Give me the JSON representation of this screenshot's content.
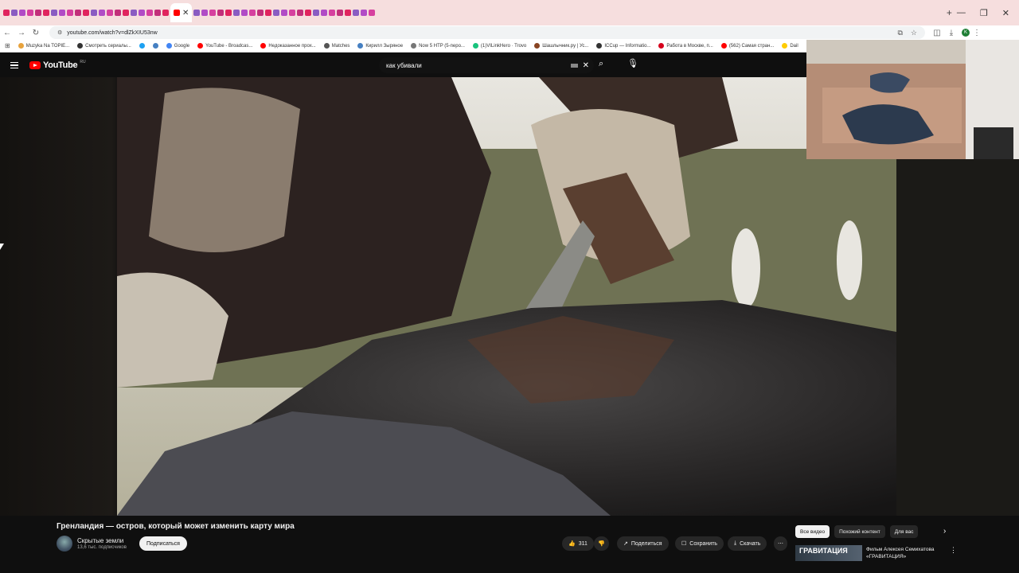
{
  "browser": {
    "url": "youtube.com/watch?v=dlZkXIU53nw",
    "bookmarks": [
      {
        "label": "Muzyka Na TOPIE...",
        "color": "#e8a33d"
      },
      {
        "label": "Смотреть сериалы...",
        "color": "#333333"
      },
      {
        "label": "",
        "color": "#1da1f2"
      },
      {
        "label": "",
        "color": "#4680c2"
      },
      {
        "label": "Google",
        "color": "#4285f4"
      },
      {
        "label": "YouTube - Broadcas...",
        "color": "#ff0000"
      },
      {
        "label": "Недоказанное прох...",
        "color": "#ff0000"
      },
      {
        "label": "Matches",
        "color": "#555555"
      },
      {
        "label": "Кирилл Зыряное",
        "color": "#4680c2"
      },
      {
        "label": "Now 5 HTP (5-перо...",
        "color": "#777777"
      },
      {
        "label": "(1)VILinkHero · Trovo",
        "color": "#19c37d"
      },
      {
        "label": "Шашлычник.ру | Ус...",
        "color": "#884422"
      },
      {
        "label": "ICCup — Informatio...",
        "color": "#333333"
      },
      {
        "label": "Работа в Москве, п...",
        "color": "#d6001c"
      },
      {
        "label": "(562) Самая стран...",
        "color": "#ff0000"
      },
      {
        "label": "Dail",
        "color": "#ffcc00"
      }
    ]
  },
  "youtube": {
    "region": "RU",
    "logo_text": "YouTube",
    "search_query": "как убивали",
    "video_title": "Гренландия — остров, который может изменить карту мира",
    "channel_name": "Скрытые земли",
    "subscribers": "13,6 тыс. подписчиков",
    "subscribe_label": "Подписаться",
    "likes": "311",
    "share_label": "Поделиться",
    "save_label": "Сохранить",
    "download_label": "Скачать",
    "chips": [
      "Все видео",
      "Похожий контент",
      "Для вас"
    ],
    "recommendation": {
      "thumb_text": "ГРАВИТАЦИЯ",
      "title": "Фильм Алексея Семихатова «ГРАВИТАЦИЯ»"
    }
  }
}
